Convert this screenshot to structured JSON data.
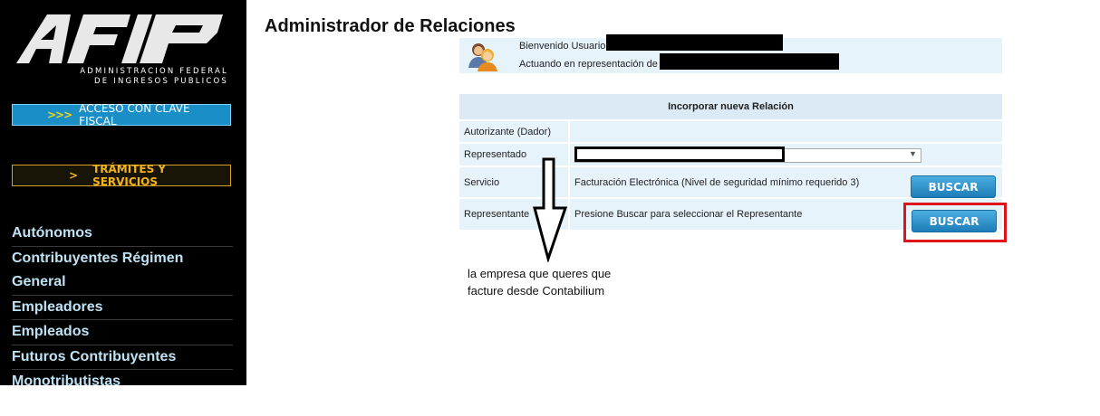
{
  "sidebar": {
    "logo_text": "AFIP",
    "logo_subtitle_1": "ADMINISTRACION FEDERAL",
    "logo_subtitle_2": "DE INGRESOS PUBLICOS",
    "acceso_arrows": ">>>",
    "acceso_label": "ACCESO CON CLAVE FISCAL",
    "tramites_arrow": ">",
    "tramites_label": "TRÁMITES Y SERVICIOS",
    "menu": [
      "Autónomos",
      "Contribuyentes Régimen General",
      "Empleadores",
      "Empleados",
      "Futuros Contribuyentes",
      "Monotributistas"
    ]
  },
  "main": {
    "title": "Administrador de Relaciones",
    "welcome": {
      "icon": "users-icon",
      "line1": "Bienvenido Usuario",
      "line2": "Actuando en representación de"
    },
    "form": {
      "header": "Incorporar nueva Relación",
      "rows": [
        {
          "label": "Autorizante (Dador)",
          "value": ""
        },
        {
          "label": "Representado",
          "value": ""
        },
        {
          "label": "Servicio",
          "value": "Facturación Electrónica (Nivel de seguridad mínimo requerido 3)",
          "button": "BUSCAR"
        },
        {
          "label": "Representante",
          "value": "Presione Buscar para seleccionar el Representante",
          "button": "BUSCAR"
        }
      ]
    },
    "annotation": {
      "line1": "la empresa que queres que",
      "line2": "facture desde Contabilium"
    }
  },
  "colors": {
    "accent_blue": "#1a8fc7",
    "highlight_red": "#e0141b",
    "panel_bg": "#e6f3fb",
    "tramites_gold": "#f2b41c"
  }
}
